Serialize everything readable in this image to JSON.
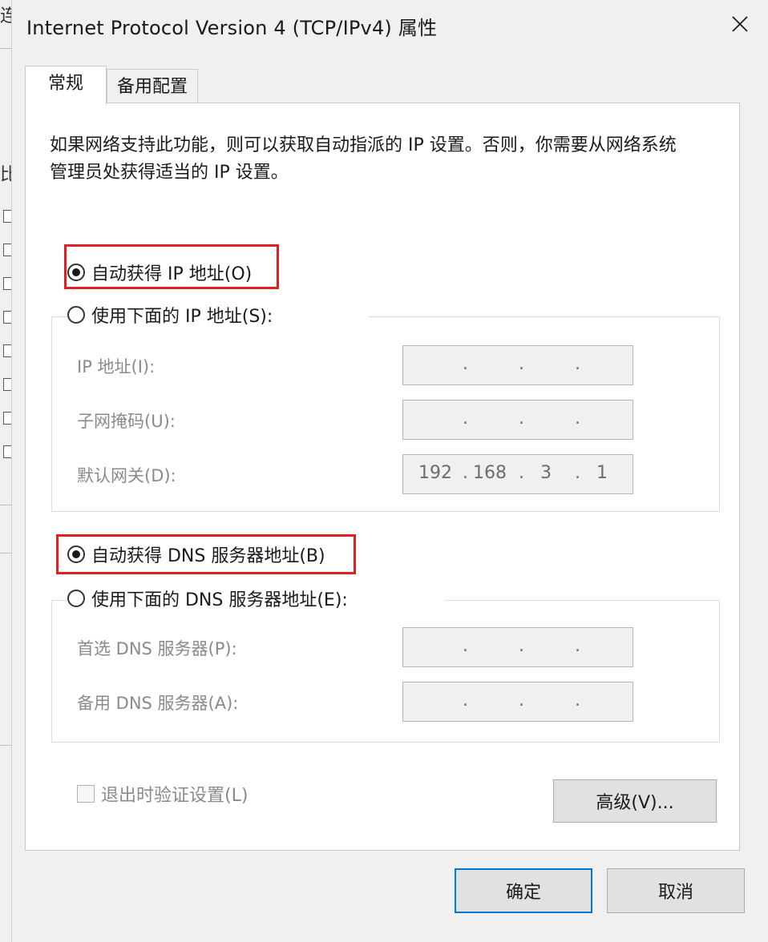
{
  "window": {
    "title": "Internet Protocol Version 4 (TCP/IPv4) 属性",
    "close_icon": "close-icon",
    "background_fragments": [
      "连",
      "比"
    ]
  },
  "tabs": [
    {
      "label": "常规",
      "active": true
    },
    {
      "label": "备用配置",
      "active": false
    }
  ],
  "description": "如果网络支持此功能，则可以获取自动指派的 IP 设置。否则，你需要从网络系统管理员处获得适当的 IP 设置。",
  "ip": {
    "auto_label": "自动获得 IP 地址(O)",
    "auto_selected": true,
    "manual_label": "使用下面的 IP 地址(S):",
    "manual_selected": false,
    "fields": [
      {
        "label": "IP 地址(I):",
        "octets": [
          "",
          "",
          "",
          ""
        ]
      },
      {
        "label": "子网掩码(U):",
        "octets": [
          "",
          "",
          "",
          ""
        ]
      },
      {
        "label": "默认网关(D):",
        "octets": [
          "192",
          "168",
          "3",
          "1"
        ]
      }
    ]
  },
  "dns": {
    "auto_label": "自动获得 DNS 服务器地址(B)",
    "auto_selected": true,
    "manual_label": "使用下面的 DNS 服务器地址(E):",
    "manual_selected": false,
    "fields": [
      {
        "label": "首选 DNS 服务器(P):",
        "octets": [
          "",
          "",
          "",
          ""
        ]
      },
      {
        "label": "备用 DNS 服务器(A):",
        "octets": [
          "",
          "",
          "",
          ""
        ]
      }
    ]
  },
  "validate_label": "退出时验证设置(L)",
  "validate_checked": false,
  "buttons": {
    "advanced": "高级(V)...",
    "ok": "确定",
    "cancel": "取消"
  },
  "colors": {
    "highlight_border": "#e02020",
    "primary_button_border": "#0078d7",
    "dialog_background": "#f0f0f0"
  }
}
